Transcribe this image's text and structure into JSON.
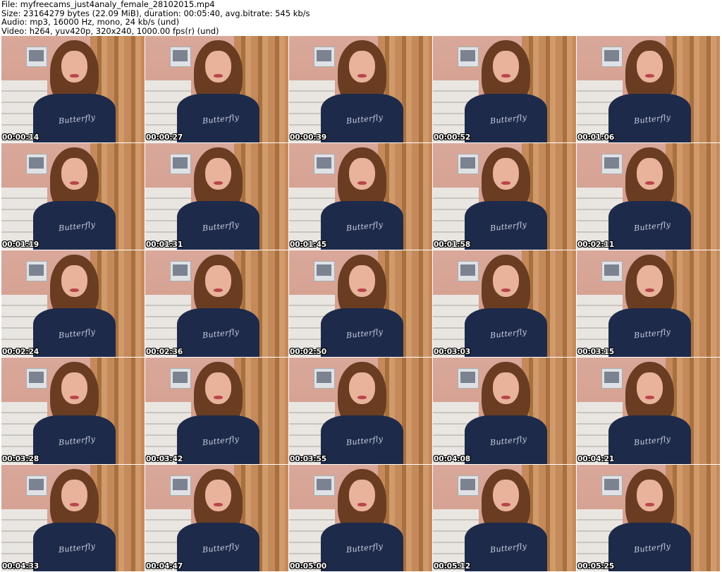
{
  "header": {
    "file_line": "File: myfreecams_just4analy_female_28102015.mp4",
    "size_line": "Size: 23164279 bytes (22.09 MiB), duration: 00:05:40, avg.bitrate: 545 kb/s",
    "audio_line": "Audio: mp3, 16000 Hz, mono, 24 kb/s (und)",
    "video_line": "Video: h264, yuv420p, 320x240, 1000.00 fps(r) (und)"
  },
  "shirt_print_text": "Butterfly",
  "thumbnails": [
    {
      "timestamp": "00:00:14"
    },
    {
      "timestamp": "00:00:27"
    },
    {
      "timestamp": "00:00:39"
    },
    {
      "timestamp": "00:00:52"
    },
    {
      "timestamp": "00:01:06"
    },
    {
      "timestamp": "00:01:19"
    },
    {
      "timestamp": "00:01:31"
    },
    {
      "timestamp": "00:01:45"
    },
    {
      "timestamp": "00:01:58"
    },
    {
      "timestamp": "00:02:11"
    },
    {
      "timestamp": "00:02:24"
    },
    {
      "timestamp": "00:02:36"
    },
    {
      "timestamp": "00:02:50"
    },
    {
      "timestamp": "00:03:03"
    },
    {
      "timestamp": "00:03:15"
    },
    {
      "timestamp": "00:03:28"
    },
    {
      "timestamp": "00:03:42"
    },
    {
      "timestamp": "00:03:55"
    },
    {
      "timestamp": "00:04:08"
    },
    {
      "timestamp": "00:04:21"
    },
    {
      "timestamp": "00:04:33"
    },
    {
      "timestamp": "00:04:47"
    },
    {
      "timestamp": "00:05:00"
    },
    {
      "timestamp": "00:05:12"
    },
    {
      "timestamp": "00:05:25"
    }
  ]
}
